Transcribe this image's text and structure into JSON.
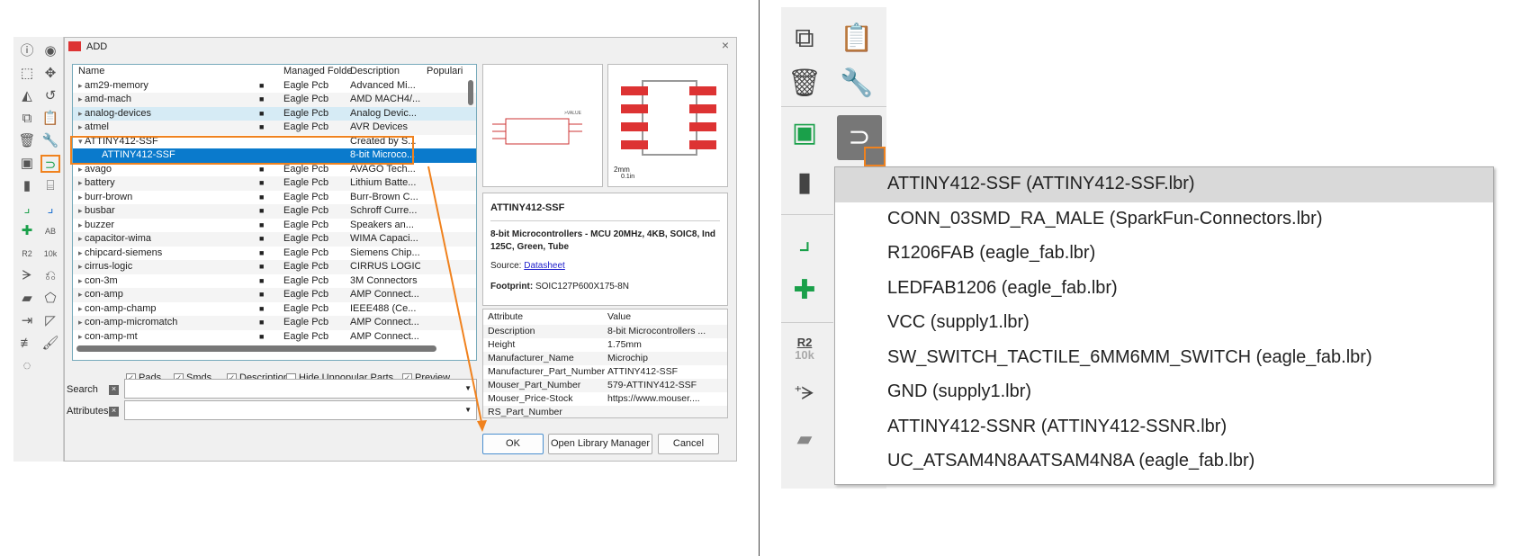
{
  "dialog": {
    "title": "ADD",
    "logo": "ADD",
    "close": "×",
    "columns": [
      "Name",
      "",
      "Managed Folde",
      "Description",
      "Populari"
    ],
    "rows": [
      {
        "name": "am29-memory",
        "folder": "Eagle Pcb",
        "desc": "Advanced Mi..."
      },
      {
        "name": "amd-mach",
        "folder": "Eagle Pcb",
        "desc": "AMD MACH4/..."
      },
      {
        "name": "analog-devices",
        "folder": "Eagle Pcb",
        "desc": "Analog Devic...",
        "state": "hl"
      },
      {
        "name": "atmel",
        "folder": "Eagle Pcb",
        "desc": "AVR Devices"
      },
      {
        "name": "ATTINY412-SSF",
        "folder": "",
        "desc": "Created by S...",
        "expanded": true
      },
      {
        "name": "ATTINY412-SSF",
        "folder": "",
        "desc": "8-bit Microco...",
        "state": "sel",
        "child": true
      },
      {
        "name": "avago",
        "folder": "Eagle Pcb",
        "desc": "AVAGO Tech..."
      },
      {
        "name": "battery",
        "folder": "Eagle Pcb",
        "desc": "Lithium Batte..."
      },
      {
        "name": "burr-brown",
        "folder": "Eagle Pcb",
        "desc": "Burr-Brown C..."
      },
      {
        "name": "busbar",
        "folder": "Eagle Pcb",
        "desc": "Schroff Curre..."
      },
      {
        "name": "buzzer",
        "folder": "Eagle Pcb",
        "desc": "Speakers an..."
      },
      {
        "name": "capacitor-wima",
        "folder": "Eagle Pcb",
        "desc": "WIMA Capaci..."
      },
      {
        "name": "chipcard-siemens",
        "folder": "Eagle Pcb",
        "desc": "Siemens Chip..."
      },
      {
        "name": "cirrus-logic",
        "folder": "Eagle Pcb",
        "desc": "CIRRUS LOGIC"
      },
      {
        "name": "con-3m",
        "folder": "Eagle Pcb",
        "desc": "3M Connectors"
      },
      {
        "name": "con-amp",
        "folder": "Eagle Pcb",
        "desc": "AMP Connect..."
      },
      {
        "name": "con-amp-champ",
        "folder": "Eagle Pcb",
        "desc": "IEEE488 (Ce..."
      },
      {
        "name": "con-amp-micromatch",
        "folder": "Eagle Pcb",
        "desc": "AMP Connect..."
      },
      {
        "name": "con-amp-mt",
        "folder": "Eagle Pcb",
        "desc": "AMP Connect..."
      }
    ],
    "checkboxes": [
      {
        "label": "Pads",
        "checked": true
      },
      {
        "label": "Smds",
        "checked": true
      },
      {
        "label": "Description",
        "checked": true
      },
      {
        "label": "Hide Unpopular Parts",
        "checked": false
      },
      {
        "label": "Preview",
        "checked": true
      }
    ],
    "search_label": "Search",
    "attributes_label": "Attributes",
    "scale_mm": "2mm",
    "scale_in": "0.1in",
    "info": {
      "name": "ATTINY412-SSF",
      "desc": "8-bit Microcontrollers - MCU 20MHz, 4KB, SOIC8, Ind 125C, Green, Tube",
      "source_label": "Source:",
      "source_link": "Datasheet",
      "footprint_label": "Footprint:",
      "footprint": "SOIC127P600X175-8N"
    },
    "attr_headers": [
      "Attribute",
      "Value"
    ],
    "attrs": [
      [
        "Description",
        "8-bit Microcontrollers ..."
      ],
      [
        "Height",
        "1.75mm"
      ],
      [
        "Manufacturer_Name",
        "Microchip"
      ],
      [
        "Manufacturer_Part_Number",
        "ATTINY412-SSF"
      ],
      [
        "Mouser_Part_Number",
        "579-ATTINY412-SSF"
      ],
      [
        "Mouser_Price-Stock",
        "https://www.mouser...."
      ],
      [
        "RS_Part_Number",
        ""
      ]
    ],
    "buttons": {
      "ok": "OK",
      "library": "Open Library Manager",
      "cancel": "Cancel"
    }
  },
  "recent_menu": [
    "ATTINY412-SSF (ATTINY412-SSF.lbr)",
    "CONN_03SMD_RA_MALE (SparkFun-Connectors.lbr)",
    "R1206FAB (eagle_fab.lbr)",
    "LEDFAB1206 (eagle_fab.lbr)",
    "VCC (supply1.lbr)",
    "SW_SWITCH_TACTILE_6MM6MM_SWITCH (eagle_fab.lbr)",
    "GND (supply1.lbr)",
    "ATTINY412-SSNR (ATTINY412-SSNR.lbr)",
    "UC_ATSAM4N8AATSAM4N8A (eagle_fab.lbr)"
  ],
  "toolbar_text": {
    "r2": "R2",
    "v10k": "10k",
    "ab": "AB"
  },
  "colors": {
    "accent": "#0a7acc",
    "highlight": "#f0821e",
    "green": "#1aa04a"
  }
}
